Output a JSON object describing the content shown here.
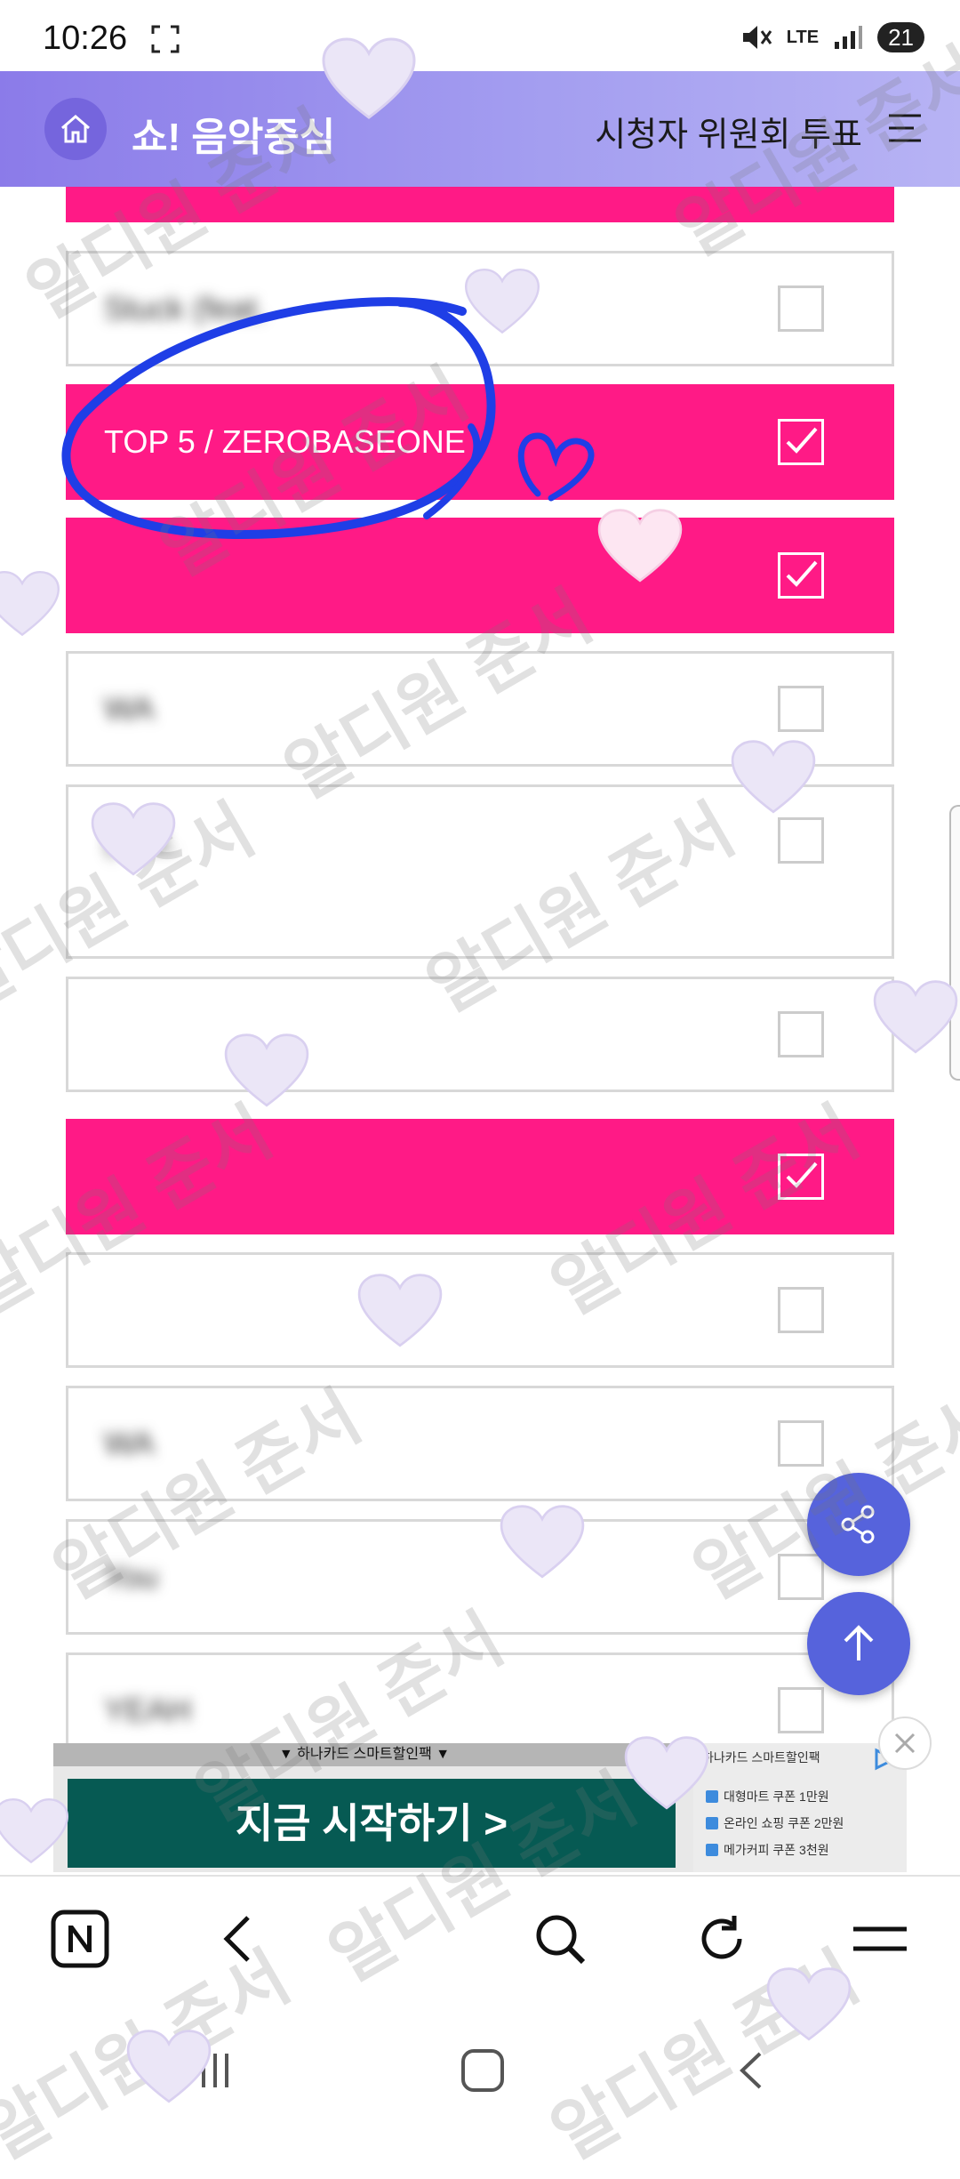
{
  "status_bar": {
    "time": "10:26",
    "network": "LTE",
    "battery": "21"
  },
  "header": {
    "title": "쇼! 음악중심",
    "subtitle": "시청자 위원회 투표",
    "brand_color": "#8b7be9"
  },
  "vote_list": {
    "rows": [
      {
        "label": "",
        "selected": true
      },
      {
        "label": "Stuck (feat.",
        "selected": false,
        "blurred": true
      },
      {
        "label": "TOP 5 / ZEROBASEONE",
        "selected": true
      },
      {
        "label": "",
        "selected": true,
        "blurred": true
      },
      {
        "label": "WA",
        "selected": false,
        "blurred": true
      },
      {
        "label": "(feat.",
        "label2": "",
        "selected": false,
        "blurred": true
      },
      {
        "label": "",
        "selected": false,
        "blurred": true
      },
      {
        "label": "",
        "selected": true,
        "blurred": true
      },
      {
        "label": "",
        "selected": false,
        "blurred": true
      },
      {
        "label": "WA",
        "selected": false,
        "blurred": true
      },
      {
        "label": "You",
        "selected": false,
        "blurred": true
      },
      {
        "label": "YEAH",
        "selected": false,
        "blurred": true
      }
    ],
    "selected_color": "#ff1a86"
  },
  "fabs": {
    "share": "share-icon",
    "top": "arrow-up-icon"
  },
  "ad": {
    "banner_text": "▼ 하나카드 스마트할인팩 ▼",
    "cta": "지금 시작하기 >",
    "panel_title": "하나카드 스마트할인팩",
    "items": [
      "대형마트 쿠폰 1만원",
      "온라인 쇼핑 쿠폰 2만원",
      "메가커피 쿠폰 3천원"
    ]
  },
  "overlay": {
    "watermark": "알디원 준서"
  }
}
